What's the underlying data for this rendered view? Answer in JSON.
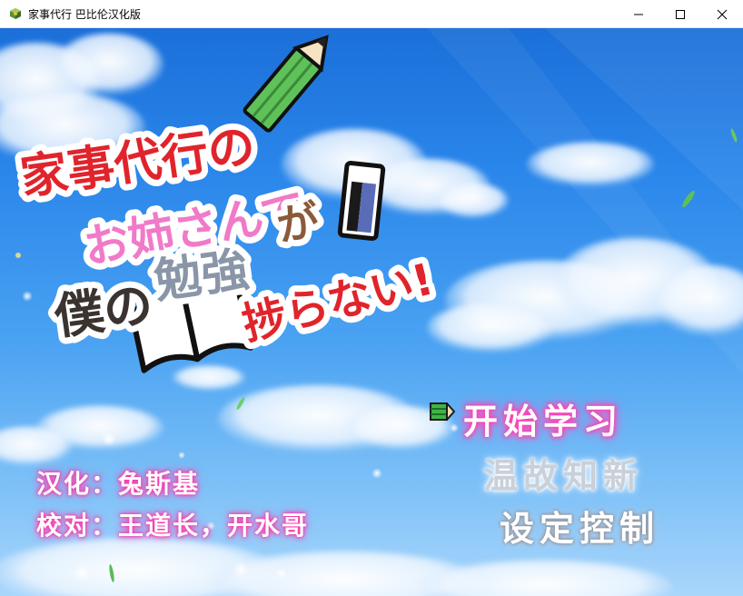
{
  "window": {
    "title": "家事代行 巴比伦汉化版",
    "minimize_icon": "minimize-icon",
    "maximize_icon": "maximize-icon",
    "close_icon": "close-icon"
  },
  "logo": {
    "line1": "家事代行の",
    "line2": "お姉さんで",
    "line3a": "僕の",
    "line3b": "勉強",
    "line3c": "が",
    "line4": "捗らない!"
  },
  "menu": {
    "start": "开始学习",
    "continue": "温故知新",
    "settings": "设定控制",
    "cursor_icon": "pencil-cursor-icon"
  },
  "credits": {
    "translation": "汉化：兔斯基",
    "proofreading": "校对：王道长，开水哥"
  },
  "colors": {
    "sky_top": "#1b6fd9",
    "sky_bottom": "#a9d6fb",
    "glow_pink": "#ff3fb3",
    "logo_red": "#e0242c",
    "logo_pink": "#f07ac8",
    "logo_gray": "#8a96a8"
  }
}
